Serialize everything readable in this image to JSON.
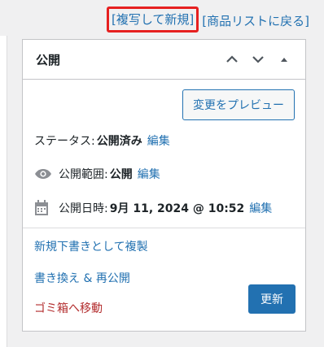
{
  "top_links": {
    "copy_new_draft": "[複写して新規]",
    "back_to_list": "[商品リストに戻る]"
  },
  "publish_box": {
    "title": "公開",
    "header_buttons": [
      "chevron-up-icon",
      "chevron-down-icon",
      "caret-up-icon"
    ],
    "preview_button": "変更をプレビュー",
    "status": {
      "label": "ステータス:",
      "value": "公開済み",
      "edit": "編集"
    },
    "visibility": {
      "label": "公開範囲:",
      "value": "公開",
      "edit": "編集"
    },
    "published_on": {
      "label": "公開日時:",
      "value": "9月 11, 2024 @ 10:52",
      "edit": "編集"
    },
    "new_draft_link": "新規下書きとして複製",
    "rewrite_link": "書き換え & 再公開",
    "trash_link": "ゴミ箱へ移動",
    "update_button": "更新"
  },
  "colors": {
    "link": "#2271b1",
    "danger": "#b32d2e",
    "highlight_annotation": "#e62020",
    "primary_button": "#2271b1"
  }
}
